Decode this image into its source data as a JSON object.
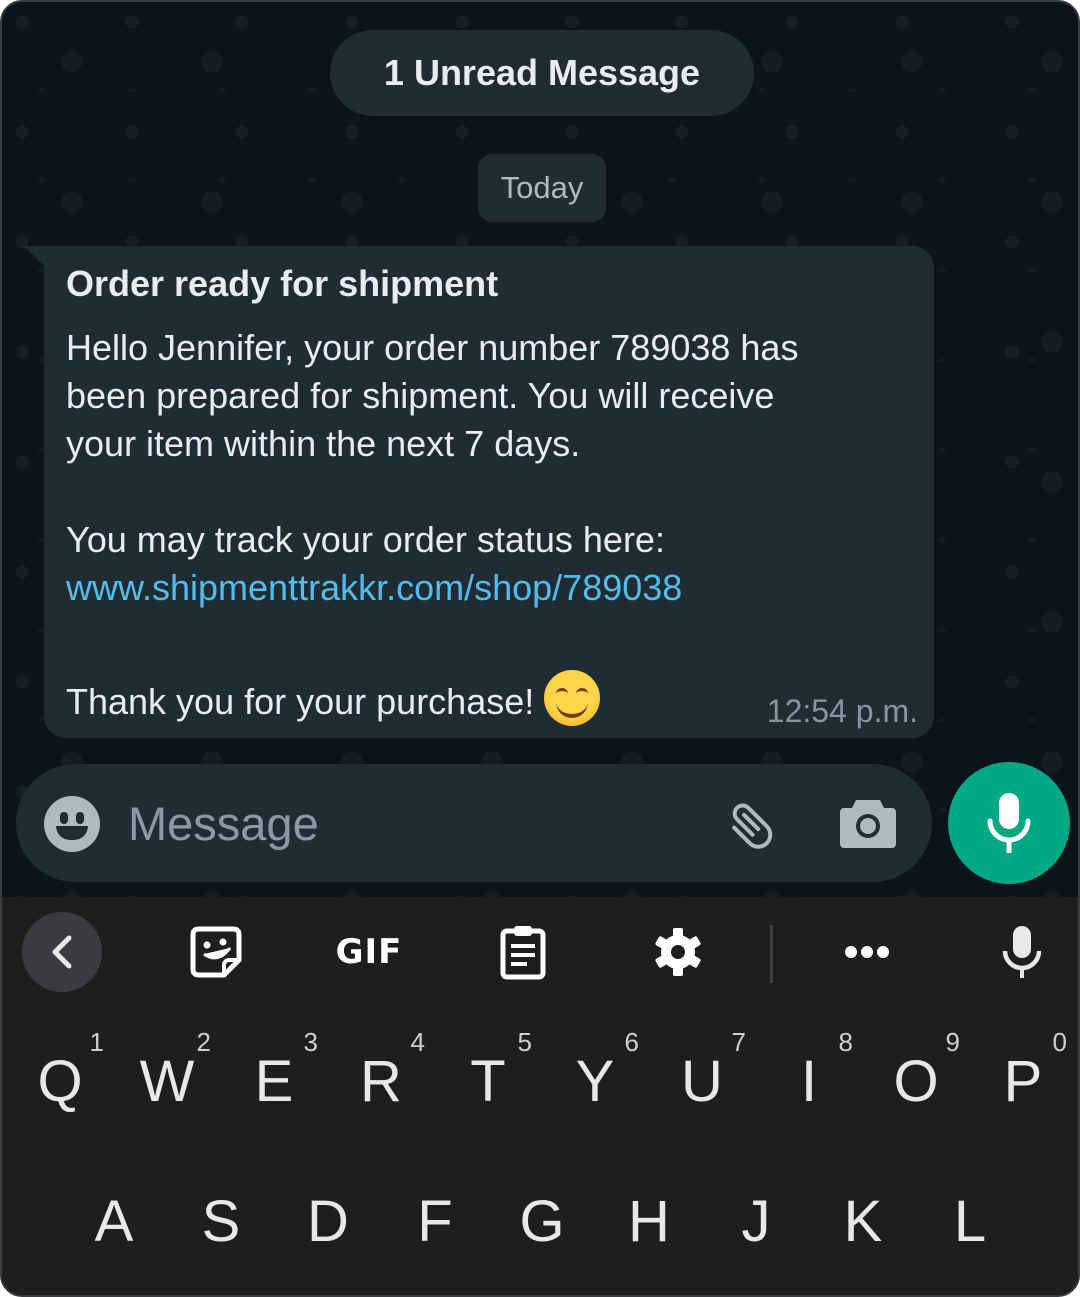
{
  "chat": {
    "unread_banner": "1 Unread Message",
    "date_divider": "Today",
    "message": {
      "title": "Order ready for shipment",
      "body_lines": [
        "Hello Jennifer, your order number 789038 has",
        "been prepared for shipment. You will receive",
        "your item within the next 7 days."
      ],
      "track_line": "You may track your order status here:",
      "link": "www.shipmenttrakkr.com/shop/789038",
      "closing": "Thank you for your purchase!",
      "emoji": "smiling-face-with-smiling-eyes",
      "time": "12:54 p.m."
    }
  },
  "composer": {
    "placeholder": "Message",
    "value": "",
    "icons": [
      "emoji-icon",
      "paperclip-icon",
      "camera-icon",
      "microphone-icon"
    ]
  },
  "keyboard": {
    "toolbar": {
      "back": "chevron-left-icon",
      "sticker": "sticker-icon",
      "gif_label": "GIF",
      "clipboard": "clipboard-icon",
      "settings": "gear-icon",
      "more": "more-horizontal-icon",
      "voice": "microphone-icon"
    },
    "row1": [
      {
        "letter": "Q",
        "hint": "1"
      },
      {
        "letter": "W",
        "hint": "2"
      },
      {
        "letter": "E",
        "hint": "3"
      },
      {
        "letter": "R",
        "hint": "4"
      },
      {
        "letter": "T",
        "hint": "5"
      },
      {
        "letter": "Y",
        "hint": "6"
      },
      {
        "letter": "U",
        "hint": "7"
      },
      {
        "letter": "I",
        "hint": "8"
      },
      {
        "letter": "O",
        "hint": "9"
      },
      {
        "letter": "P",
        "hint": "0"
      }
    ],
    "row2": [
      {
        "letter": "A"
      },
      {
        "letter": "S"
      },
      {
        "letter": "D"
      },
      {
        "letter": "F"
      },
      {
        "letter": "G"
      },
      {
        "letter": "H"
      },
      {
        "letter": "J"
      },
      {
        "letter": "K"
      },
      {
        "letter": "L"
      }
    ]
  },
  "colors": {
    "chat_background": "#0b141a",
    "bubble": "#202c33",
    "link": "#53bdeb",
    "accent_green": "#00a884",
    "keyboard_background": "#1e1e1e"
  }
}
